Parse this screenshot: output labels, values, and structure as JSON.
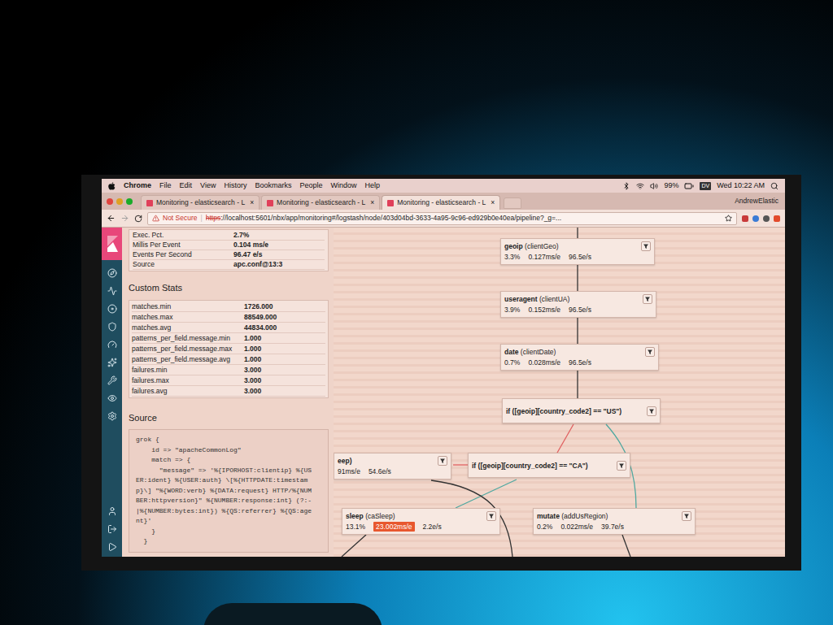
{
  "menubar": {
    "app": "Chrome",
    "items": [
      "File",
      "Edit",
      "View",
      "History",
      "Bookmarks",
      "People",
      "Window",
      "Help"
    ],
    "battery": "99%",
    "badge": "DV",
    "clock": "Wed 10:22 AM"
  },
  "tabs": [
    {
      "label": "Monitoring - elasticsearch - L",
      "close": "×",
      "selected": false
    },
    {
      "label": "Monitoring - elasticsearch - L",
      "close": "×",
      "selected": false
    },
    {
      "label": "Monitoring - elasticsearch - L",
      "close": "×",
      "selected": true
    }
  ],
  "profile": "AndrewElastic",
  "address": {
    "warning": "Not Secure",
    "scheme": "https",
    "url": "://localhost:5601/nbx/app/monitoring#/logstash/node/403d04bd-3633-4a95-9c96-ed929b0e40ea/pipeline?_g=..."
  },
  "stats": [
    {
      "label": "Exec. Pct.",
      "value": "2.7%"
    },
    {
      "label": "Millis Per Event",
      "value": "0.104 ms/e"
    },
    {
      "label": "Events Per Second",
      "value": "96.47 e/s"
    },
    {
      "label": "Source",
      "value": "apc.conf@13:3"
    }
  ],
  "custom_stats": {
    "title": "Custom Stats",
    "rows": [
      {
        "label": "matches.min",
        "value": "1726.000"
      },
      {
        "label": "matches.max",
        "value": "88549.000"
      },
      {
        "label": "matches.avg",
        "value": "44834.000"
      },
      {
        "label": "patterns_per_field.message.min",
        "value": "1.000"
      },
      {
        "label": "patterns_per_field.message.max",
        "value": "1.000"
      },
      {
        "label": "patterns_per_field.message.avg",
        "value": "1.000"
      },
      {
        "label": "failures.min",
        "value": "3.000"
      },
      {
        "label": "failures.max",
        "value": "3.000"
      },
      {
        "label": "failures.avg",
        "value": "3.000"
      }
    ]
  },
  "source": {
    "title": "Source",
    "lines": [
      "grok {",
      "    id => \"apacheCommonLog\"",
      "    match => {",
      "      \"message\" => '%{IPORHOST:clientip} %{US",
      "ER:ident} %{USER:auth} \\[%{HTTPDATE:timestam",
      "p}\\] \"%{WORD:verb} %{DATA:request} HTTP/%{NUM",
      "BER:httpversion}\" %{NUMBER:response:int} (?:-",
      "|%{NUMBER:bytes:int}) %{QS:referrer} %{QS:age",
      "nt}'",
      "    }",
      "  }"
    ]
  },
  "nodes": [
    {
      "kind": "plugin",
      "name": "geoip",
      "id_label": "(clientGeo)",
      "stats": [
        {
          "text": "3.3%",
          "alert": false
        },
        {
          "text": "0.127ms/e",
          "alert": false
        },
        {
          "text": "96.5e/s",
          "alert": false
        }
      ]
    },
    {
      "kind": "plugin",
      "name": "useragent",
      "id_label": "(clientUA)",
      "stats": [
        {
          "text": "3.9%",
          "alert": false
        },
        {
          "text": "0.152ms/e",
          "alert": false
        },
        {
          "text": "96.5e/s",
          "alert": false
        }
      ]
    },
    {
      "kind": "plugin",
      "name": "date",
      "id_label": "(clientDate)",
      "stats": [
        {
          "text": "0.7%",
          "alert": false
        },
        {
          "text": "0.028ms/e",
          "alert": false
        },
        {
          "text": "96.5e/s",
          "alert": false
        }
      ]
    },
    {
      "kind": "if",
      "name": "if ([geoip][country_code2] == \"US\")",
      "id_label": "",
      "stats": []
    },
    {
      "kind": "if",
      "name": "if ([geoip][country_code2] == \"CA\")",
      "id_label": "",
      "stats": []
    },
    {
      "kind": "plugin",
      "name": "eep)",
      "id_label": "",
      "stats": [
        {
          "text": "91ms/e",
          "alert": false
        },
        {
          "text": "54.6e/s",
          "alert": false
        }
      ]
    },
    {
      "kind": "plugin",
      "name": "sleep",
      "id_label": "(caSleep)",
      "stats": [
        {
          "text": "13.1%",
          "alert": false
        },
        {
          "text": "23.002ms/e",
          "alert": true
        },
        {
          "text": "2.2e/s",
          "alert": false
        }
      ]
    },
    {
      "kind": "plugin",
      "name": "mutate",
      "id_label": "(addUsRegion)",
      "stats": [
        {
          "text": "0.2%",
          "alert": false
        },
        {
          "text": "0.022ms/e",
          "alert": false
        },
        {
          "text": "39.7e/s",
          "alert": false
        }
      ]
    }
  ],
  "edges": [
    {
      "color": "#333333"
    },
    {
      "color": "#333333"
    },
    {
      "color": "#333333"
    },
    {
      "color": "#333333"
    },
    {
      "color": "#e06060"
    },
    {
      "color": "#4fa8a0"
    },
    {
      "color": "#4fa8a0"
    },
    {
      "color": "#e06060"
    },
    {
      "color": "#333333"
    },
    {
      "color": "#333333"
    },
    {
      "color": "#333333"
    }
  ]
}
